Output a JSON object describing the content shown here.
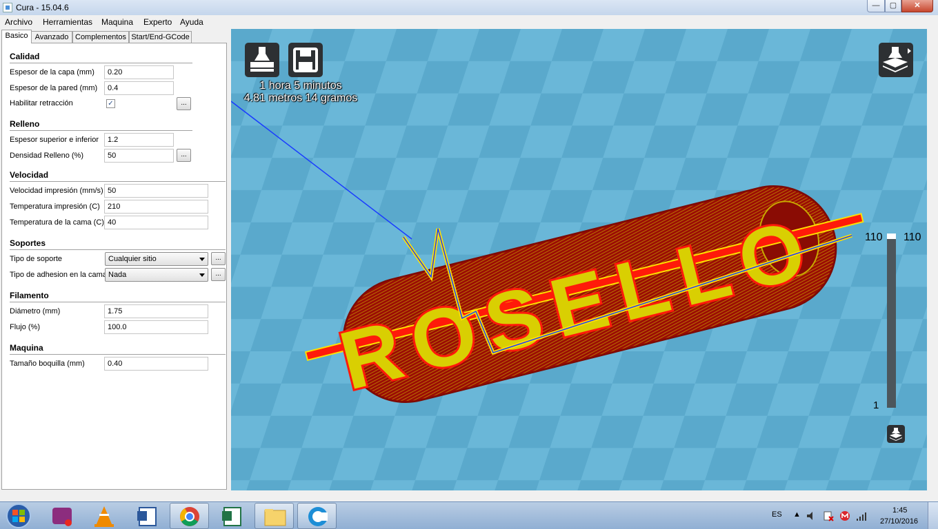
{
  "window": {
    "title": "Cura - 15.04.6",
    "minimize": "—",
    "maximize": "▢",
    "close": "✕"
  },
  "menu": [
    "Archivo",
    "Herramientas",
    "Maquina",
    "Experto",
    "Ayuda"
  ],
  "tabs": [
    "Basico",
    "Avanzado",
    "Complementos",
    "Start/End-GCode"
  ],
  "sections": {
    "calidad": "Calidad",
    "relleno": "Relleno",
    "velocidad": "Velocidad",
    "soportes": "Soportes",
    "filamento": "Filamento",
    "maquina": "Maquina"
  },
  "settings": {
    "layer_height": {
      "label": "Espesor de la capa (mm)",
      "value": "0.20"
    },
    "wall_thickness": {
      "label": "Espesor de la pared (mm)",
      "value": "0.4"
    },
    "retraction": {
      "label": "Habilitar retracción",
      "checked": true
    },
    "top_bottom": {
      "label": "Espesor superior e inferior",
      "value": "1.2"
    },
    "fill_density": {
      "label": "Densidad Relleno (%)",
      "value": "50"
    },
    "print_speed": {
      "label": "Velocidad impresión (mm/s)",
      "value": "50"
    },
    "print_temp": {
      "label": "Temperatura impresión (C)",
      "value": "210"
    },
    "bed_temp": {
      "label": "Temperatura de la cama (C)",
      "value": "40"
    },
    "support_type": {
      "label": "Tipo de soporte",
      "value": "Cualquier sitio"
    },
    "adhesion_type": {
      "label": "Tipo de adhesion en la cama",
      "value": "Nada"
    },
    "diameter": {
      "label": "Diámetro (mm)",
      "value": "1.75"
    },
    "flow": {
      "label": "Flujo (%)",
      "value": "100.0"
    },
    "nozzle": {
      "label": "Tamaño boquilla (mm)",
      "value": "0.40"
    }
  },
  "more_button": "...",
  "check_mark": "✓",
  "viewport": {
    "print_time": "1 hora 5 minutos",
    "print_material": "4.81 metros 14 gramos",
    "model_text": "ROSELLO",
    "layer_max_left": "110",
    "layer_max_right": "110",
    "layer_min": "1",
    "colors": {
      "background": "#6ab7d8",
      "checker": "#5aa9cc",
      "model_base": "#9b0e05",
      "model_text": "#d9cf02",
      "model_outline": "#ff1a0a"
    }
  },
  "taskbar": {
    "lang": "ES",
    "time": "1:45",
    "date": "27/10/2016"
  }
}
